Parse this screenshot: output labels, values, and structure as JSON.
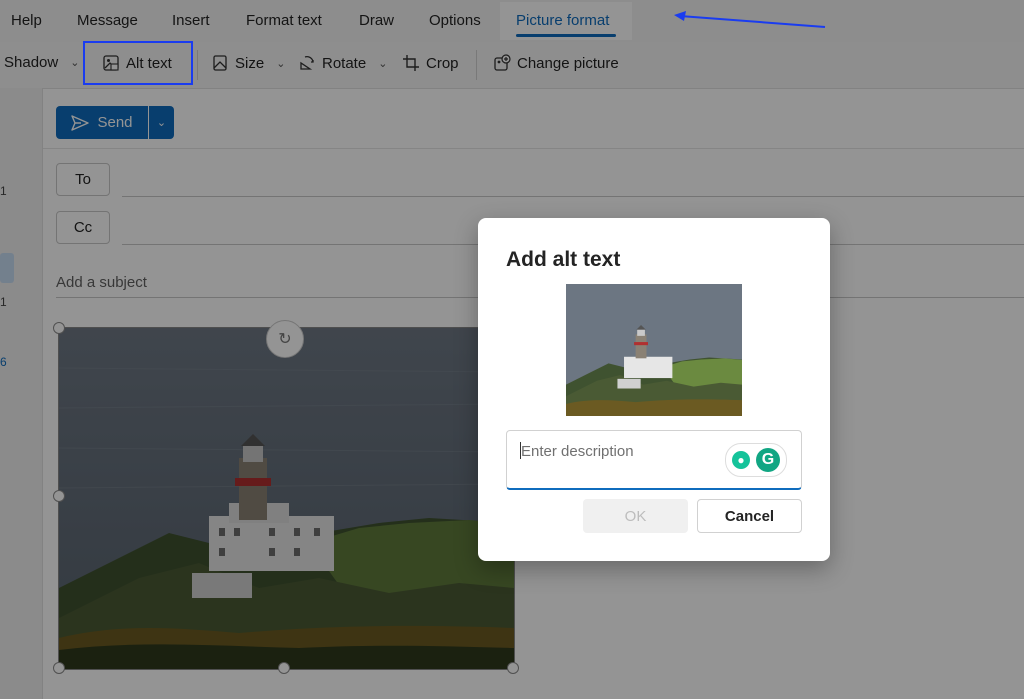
{
  "menu": {
    "tabs": [
      {
        "label": "Help"
      },
      {
        "label": "Message"
      },
      {
        "label": "Insert"
      },
      {
        "label": "Format text"
      },
      {
        "label": "Draw"
      },
      {
        "label": "Options"
      },
      {
        "label": "Picture format",
        "active": true
      }
    ]
  },
  "ribbon": {
    "shadow": "Shadow",
    "alt_text": "Alt text",
    "size": "Size",
    "rotate": "Rotate",
    "crop": "Crop",
    "change_picture": "Change picture"
  },
  "leftnav": {
    "items": [
      "1",
      "1",
      "6"
    ]
  },
  "compose": {
    "send_label": "Send",
    "to_label": "To",
    "cc_label": "Cc",
    "subject_placeholder": "Add a subject"
  },
  "dialog": {
    "title": "Add alt text",
    "description_placeholder": "Enter description",
    "description_value": "",
    "ok_label": "OK",
    "cancel_label": "Cancel",
    "grammarly_letter": "G"
  },
  "colors": {
    "accent": "#0f6cbd",
    "highlight_box": "#1a3cf0",
    "grammarly": "#11a683"
  }
}
